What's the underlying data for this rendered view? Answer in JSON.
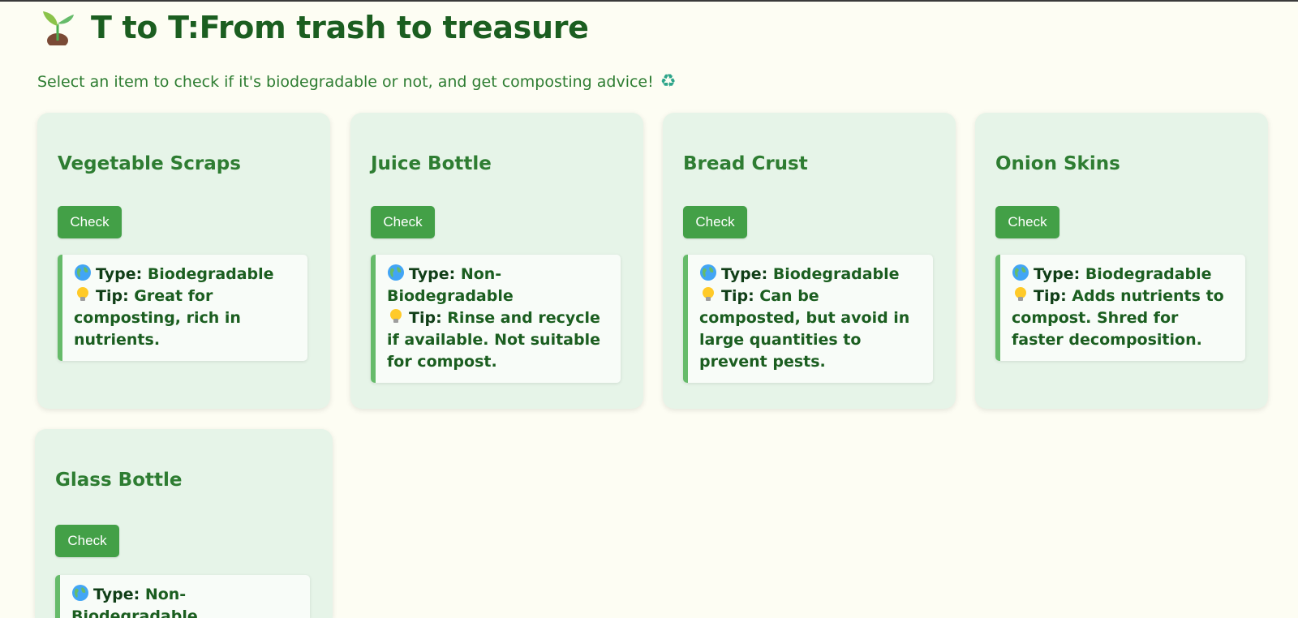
{
  "app": {
    "title": "T to T:From trash to treasure",
    "subtitle": "Select an item to check if it's biodegradable or not, and get composting advice!",
    "title_icon": "seedling-icon",
    "subtitle_icon": "recycle-icon"
  },
  "colors": {
    "background": "#fdfdf3",
    "card": "#e6f4e8",
    "title": "#1b5e20",
    "accent": "#2e7d32",
    "button": "#43a047",
    "result_border": "#66bb6a"
  },
  "labels": {
    "type": "Type:",
    "tip": "Tip:"
  },
  "items": [
    {
      "name": "Vegetable Scraps",
      "button": "Check",
      "type": "Biodegradable",
      "tip": "Great for composting, rich in nutrients."
    },
    {
      "name": "Juice Bottle",
      "button": "Check",
      "type": "Non-Biodegradable",
      "tip": "Rinse and recycle if available. Not suitable for compost."
    },
    {
      "name": "Bread Crust",
      "button": "Check",
      "type": "Biodegradable",
      "tip": "Can be composted, but avoid in large quantities to prevent pests."
    },
    {
      "name": "Onion Skins",
      "button": "Check",
      "type": "Biodegradable",
      "tip": "Adds nutrients to compost. Shred for faster decomposition."
    },
    {
      "name": "Glass Bottle",
      "button": "Check",
      "type": "Non-Biodegradable",
      "tip": ""
    }
  ]
}
